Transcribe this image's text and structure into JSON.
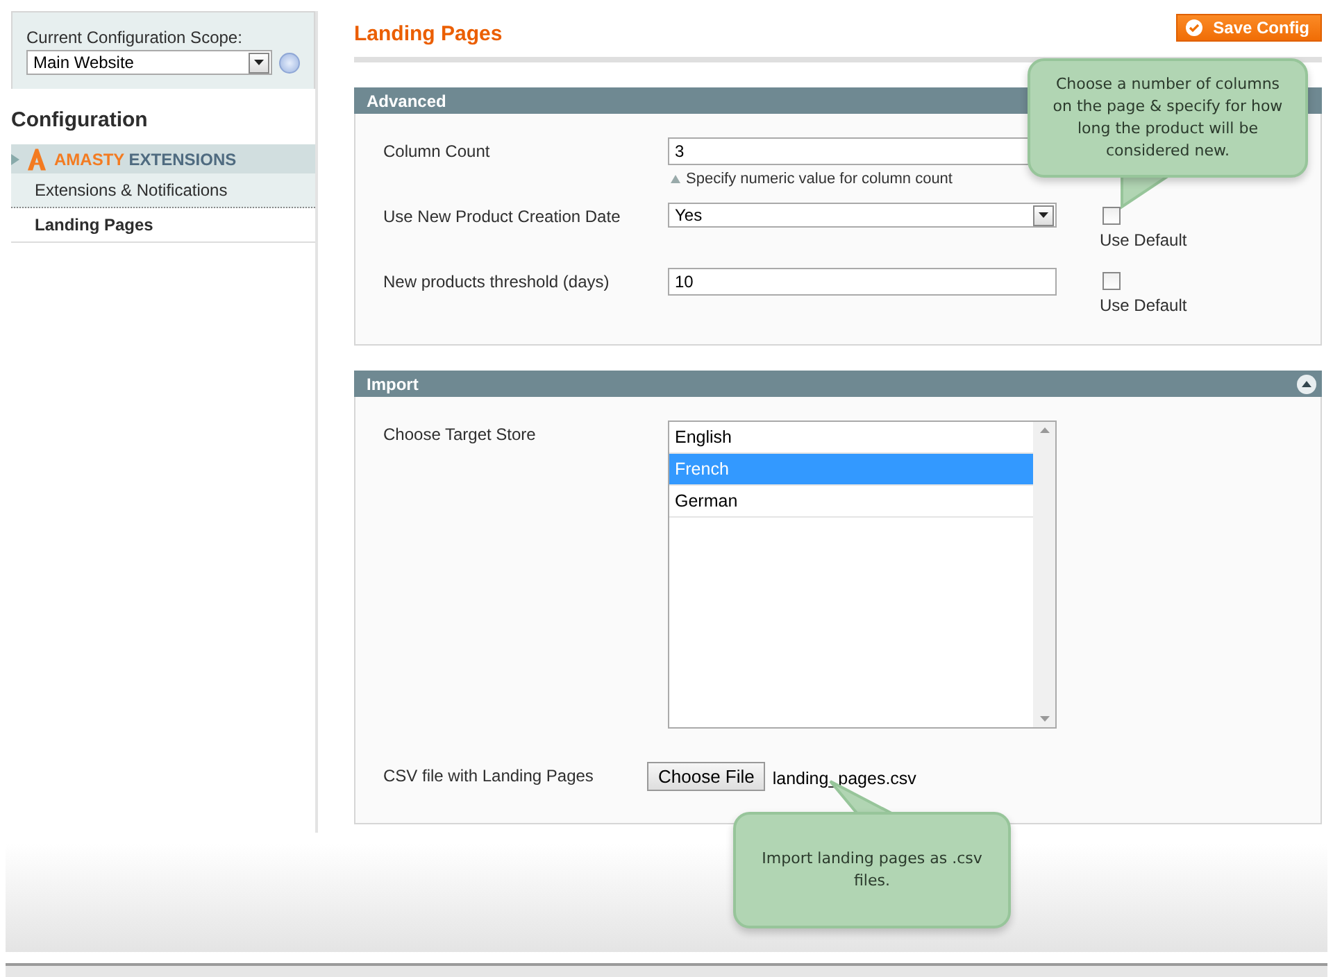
{
  "scope": {
    "label": "Current Configuration Scope:",
    "value": "Main Website"
  },
  "sidebar": {
    "title": "Configuration",
    "group": {
      "brand": "AMASTY",
      "name": "EXTENSIONS"
    },
    "items": [
      {
        "label": "Extensions & Notifications",
        "selected": false
      },
      {
        "label": "Landing Pages",
        "selected": true
      }
    ]
  },
  "page": {
    "title": "Landing Pages",
    "save_button": "Save Config"
  },
  "sections": [
    {
      "title": "Advanced",
      "fields": [
        {
          "kind": "text",
          "label": "Column Count",
          "value": "3",
          "hint": "Specify numeric value for column count"
        },
        {
          "kind": "select",
          "label": "Use New Product Creation Date",
          "value": "Yes",
          "use_default": {
            "label": "Use Default",
            "checked": false
          }
        },
        {
          "kind": "text",
          "label": "New products threshold (days)",
          "value": "10",
          "use_default": {
            "label": "Use Default",
            "checked": false
          }
        }
      ]
    },
    {
      "title": "Import",
      "fields": [
        {
          "kind": "listbox",
          "label": "Choose Target Store",
          "options": [
            {
              "label": "English",
              "selected": false
            },
            {
              "label": "French",
              "selected": true
            },
            {
              "label": "German",
              "selected": false
            }
          ]
        },
        {
          "kind": "file",
          "label": "CSV file with Landing Pages",
          "button": "Choose File",
          "value": "landing_pages.csv"
        }
      ]
    }
  ],
  "callouts": [
    {
      "text": "Choose a number of columns on the page & specify for how long the product will be considered new."
    },
    {
      "text": "Import landing pages as .csv files."
    }
  ]
}
